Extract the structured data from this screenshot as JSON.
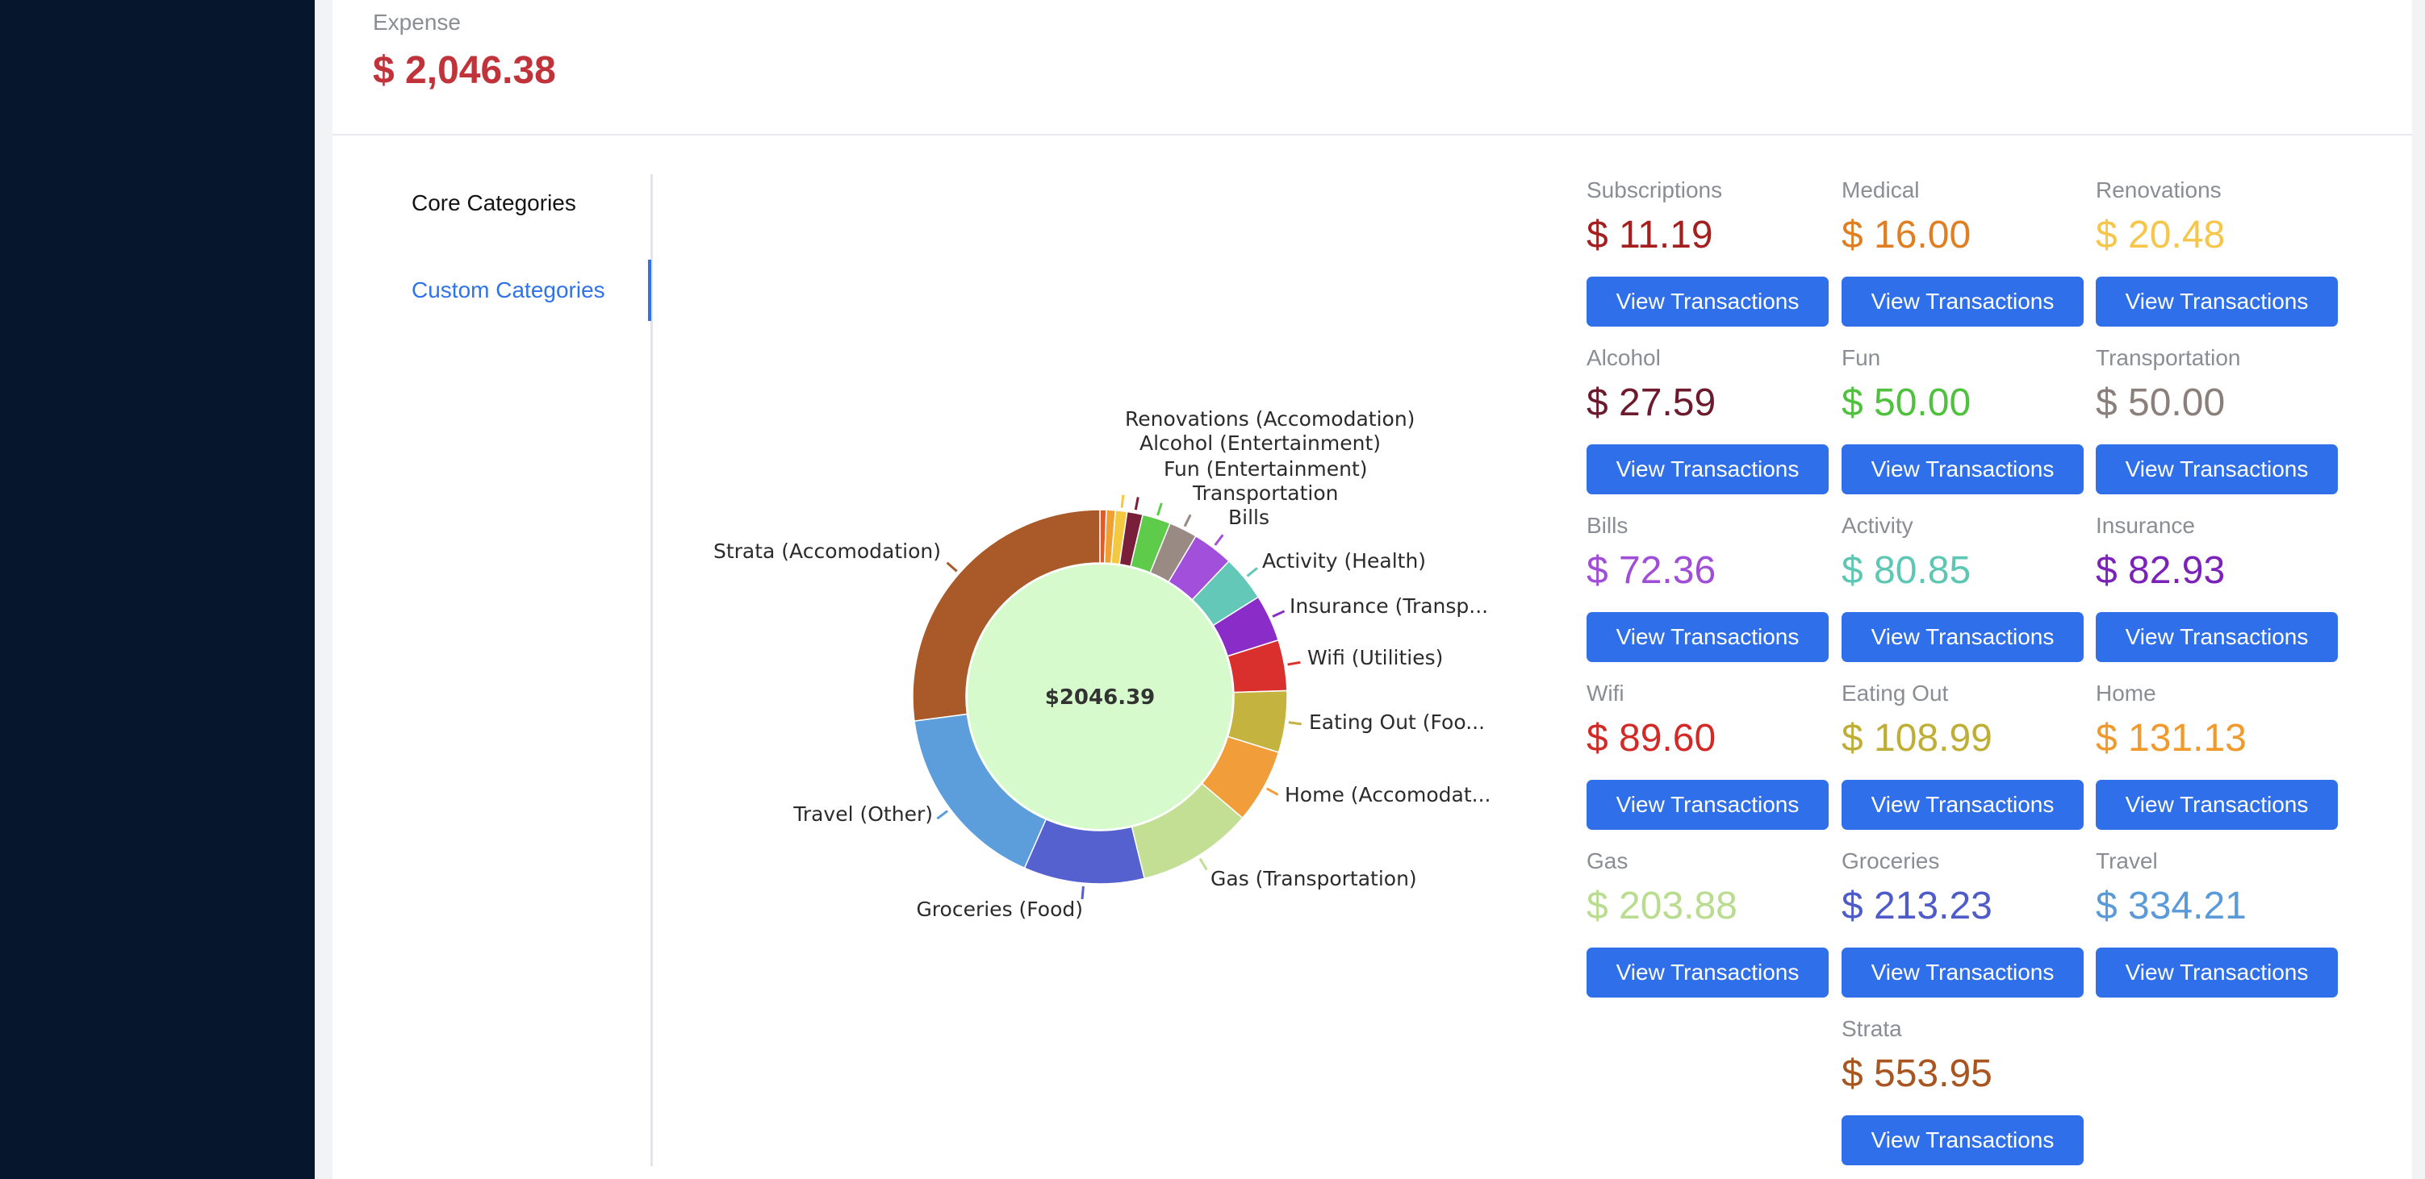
{
  "summary": {
    "label": "Expense",
    "value": "$ 2,046.38"
  },
  "tabs": [
    {
      "label": "Core Categories",
      "active": false
    },
    {
      "label": "Custom Categories",
      "active": true
    }
  ],
  "chart_data": {
    "type": "pie",
    "center_label": "$2046.39",
    "total": 2046.39,
    "slices": [
      {
        "label": "Subscriptions",
        "value": 11.19,
        "color": "#e05a2a"
      },
      {
        "label": "Medical",
        "value": 16.0,
        "color": "#f0a030"
      },
      {
        "label": "Renovations (Accomodation)",
        "value": 20.48,
        "color": "#f5c842"
      },
      {
        "label": "Alcohol (Entertainment)",
        "value": 27.59,
        "color": "#7a1f3a"
      },
      {
        "label": "Fun (Entertainment)",
        "value": 50.0,
        "color": "#5ecb4a"
      },
      {
        "label": "Transportation",
        "value": 50.0,
        "color": "#9a8a84"
      },
      {
        "label": "Bills",
        "value": 72.36,
        "color": "#a24fdc"
      },
      {
        "label": "Activity (Health)",
        "value": 80.85,
        "color": "#64c8b8"
      },
      {
        "label": "Insurance (Transp...",
        "value": 82.93,
        "color": "#8a2cc8"
      },
      {
        "label": "Wifi (Utilities)",
        "value": 89.6,
        "color": "#d9302d"
      },
      {
        "label": "Eating Out (Foo...",
        "value": 108.99,
        "color": "#c4b33e"
      },
      {
        "label": "Home (Accomodat...",
        "value": 131.13,
        "color": "#f09d3a"
      },
      {
        "label": "Gas (Transportation)",
        "value": 203.88,
        "color": "#c3df94"
      },
      {
        "label": "Groceries (Food)",
        "value": 213.23,
        "color": "#5561cf"
      },
      {
        "label": "Travel (Other)",
        "value": 334.21,
        "color": "#5c9edc"
      },
      {
        "label": "Strata (Accomodation)",
        "value": 553.95,
        "color": "#aa5a28"
      }
    ],
    "hole_color": "#d6facc"
  },
  "cards": [
    {
      "title": "Subscriptions",
      "amount": "$ 11.19",
      "color": "#a3201f",
      "button": "View Transactions"
    },
    {
      "title": "Medical",
      "amount": "$ 16.00",
      "color": "#e07f22",
      "button": "View Transactions"
    },
    {
      "title": "Renovations",
      "amount": "$ 20.48",
      "color": "#f5c64a",
      "button": "View Transactions"
    },
    {
      "title": "Alcohol",
      "amount": "$ 27.59",
      "color": "#6e1a2e",
      "button": "View Transactions"
    },
    {
      "title": "Fun",
      "amount": "$ 50.00",
      "color": "#4fc13e",
      "button": "View Transactions"
    },
    {
      "title": "Transportation",
      "amount": "$ 50.00",
      "color": "#8a7f7b",
      "button": "View Transactions"
    },
    {
      "title": "Bills",
      "amount": "$ 72.36",
      "color": "#a04ed8",
      "button": "View Transactions"
    },
    {
      "title": "Activity",
      "amount": "$ 80.85",
      "color": "#5ec7b4",
      "button": "View Transactions"
    },
    {
      "title": "Insurance",
      "amount": "$ 82.93",
      "color": "#7b22b8",
      "button": "View Transactions"
    },
    {
      "title": "Wifi",
      "amount": "$ 89.60",
      "color": "#d22b27",
      "button": "View Transactions"
    },
    {
      "title": "Eating Out",
      "amount": "$ 108.99",
      "color": "#bfae36",
      "button": "View Transactions"
    },
    {
      "title": "Home",
      "amount": "$ 131.13",
      "color": "#f09a2e",
      "button": "View Transactions"
    },
    {
      "title": "Gas",
      "amount": "$ 203.88",
      "color": "#b9dc8e",
      "button": "View Transactions"
    },
    {
      "title": "Groceries",
      "amount": "$ 213.23",
      "color": "#4e5bc9",
      "button": "View Transactions"
    },
    {
      "title": "Travel",
      "amount": "$ 334.21",
      "color": "#5a9ad8",
      "button": "View Transactions"
    },
    {
      "title": "Strata",
      "amount": "$ 553.95",
      "color": "#a85520",
      "button": "View Transactions"
    }
  ]
}
